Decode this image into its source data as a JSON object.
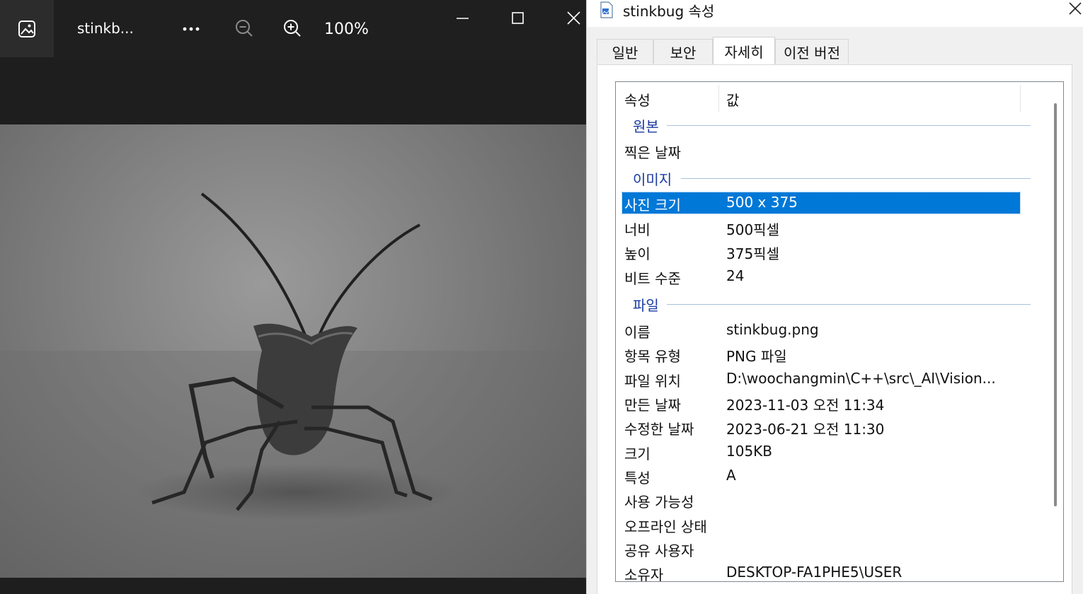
{
  "viewer": {
    "title": "stinkb...",
    "zoom": "100%",
    "icons": {
      "app": "photos-app-icon",
      "more": "more-icon",
      "zoom_out": "zoom-out-icon",
      "zoom_in": "zoom-in-icon",
      "minimize": "minimize-icon",
      "maximize": "maximize-icon",
      "close": "close-icon"
    }
  },
  "dialog": {
    "title": "stinkbug 속성",
    "tabs": [
      {
        "label": "일반"
      },
      {
        "label": "보안"
      },
      {
        "label": "자세히"
      },
      {
        "label": "이전 버전"
      }
    ],
    "active_tab": "자세히",
    "columns": {
      "property": "속성",
      "value": "값"
    },
    "groups": {
      "origin": "원본",
      "image": "이미지",
      "file": "파일"
    },
    "rows": {
      "date_taken": {
        "key": "찍은 날짜",
        "value": ""
      },
      "dimensions": {
        "key": "사진 크기",
        "value": "500 x 375"
      },
      "width": {
        "key": "너비",
        "value": "500픽셀"
      },
      "height": {
        "key": "높이",
        "value": "375픽셀"
      },
      "bit_depth": {
        "key": "비트 수준",
        "value": "24"
      },
      "name": {
        "key": "이름",
        "value": "stinkbug.png"
      },
      "item_type": {
        "key": "항목 유형",
        "value": "PNG 파일"
      },
      "folder": {
        "key": "파일 위치",
        "value": "D:\\woochangmin\\C++\\src\\_AI\\Vision..."
      },
      "created": {
        "key": "만든 날짜",
        "value": "2023-11-03 오전 11:34"
      },
      "modified": {
        "key": "수정한 날짜",
        "value": "2023-06-21 오전 11:30"
      },
      "size": {
        "key": "크기",
        "value": "105KB"
      },
      "attributes": {
        "key": "특성",
        "value": "A"
      },
      "availability": {
        "key": "사용 가능성",
        "value": ""
      },
      "offline_status": {
        "key": "오프라인 상태",
        "value": ""
      },
      "shared_with": {
        "key": "공유 사용자",
        "value": ""
      },
      "owner": {
        "key": "소유자",
        "value": "DESKTOP-FA1PHE5\\USER"
      }
    }
  },
  "colors": {
    "selection": "#0078d7",
    "group_label": "#1a3aa0",
    "viewer_bg": "#1e1e1e"
  }
}
